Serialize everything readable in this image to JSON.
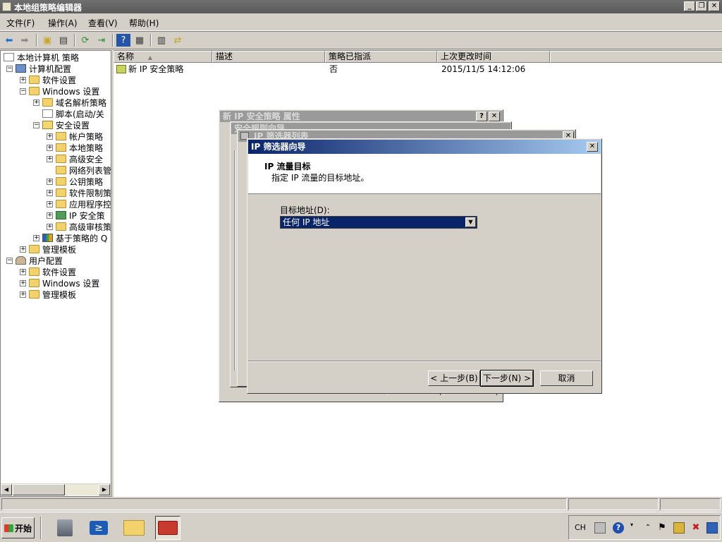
{
  "window": {
    "title": "本地组策略编辑器",
    "min": "_",
    "restore": "❐",
    "close": "✕"
  },
  "menu": [
    "文件(F)",
    "操作(A)",
    "查看(V)",
    "帮助(H)"
  ],
  "tree": {
    "root": "本地计算机 策略",
    "items": [
      {
        "label": "计算机配置",
        "exp": "−"
      },
      {
        "label": "软件设置",
        "exp": "+"
      },
      {
        "label": "Windows 设置",
        "exp": "−"
      },
      {
        "label": "域名解析策略",
        "exp": "+"
      },
      {
        "label": "脚本(启动/关",
        "exp": ""
      },
      {
        "label": "安全设置",
        "exp": "−"
      },
      {
        "label": "帐户策略",
        "exp": "+"
      },
      {
        "label": "本地策略",
        "exp": "+"
      },
      {
        "label": "高级安全",
        "exp": "+"
      },
      {
        "label": "网络列表管",
        "exp": ""
      },
      {
        "label": "公钥策略",
        "exp": "+"
      },
      {
        "label": "软件限制策",
        "exp": "+"
      },
      {
        "label": "应用程序控",
        "exp": "+"
      },
      {
        "label": "IP 安全策",
        "exp": "+"
      },
      {
        "label": "高级审核策",
        "exp": "+"
      },
      {
        "label": "基于策略的 Q",
        "exp": "+"
      },
      {
        "label": "管理模板",
        "exp": "+"
      },
      {
        "label": "用户配置",
        "exp": "−"
      },
      {
        "label": "软件设置",
        "exp": "+"
      },
      {
        "label": "Windows 设置",
        "exp": "+"
      },
      {
        "label": "管理模板",
        "exp": "+"
      }
    ]
  },
  "list": {
    "columns": [
      "名称",
      "描述",
      "策略已指派",
      "上次更改时间"
    ],
    "sort_indicator": "▲",
    "rows": [
      {
        "name": "新 IP 安全策略",
        "desc": "",
        "assigned": "否",
        "modified": "2015/11/5 14:12:06"
      }
    ]
  },
  "dialogs": {
    "properties": {
      "title": "新 IP 安全策略 属性",
      "help": "?",
      "close": "✕"
    },
    "rules": {
      "title": "安全规则向导"
    },
    "filter_list": {
      "title": "IP 筛选器列表",
      "close": "✕"
    }
  },
  "wizard": {
    "title": "IP 筛选器向导",
    "close": "✕",
    "heading": "IP 流量目标",
    "subheading": "指定 IP 流量的目标地址。",
    "field_label": "目标地址(D):",
    "selected": "任何 IP 地址",
    "back": "< 上一步(B)",
    "next": "下一步(N) >",
    "cancel": "取消"
  },
  "taskbar": {
    "start": "开始",
    "lang": "CH"
  },
  "colors": {
    "active_title": "#0a246a",
    "selection": "#0a246a",
    "face": "#d4d0c8"
  }
}
